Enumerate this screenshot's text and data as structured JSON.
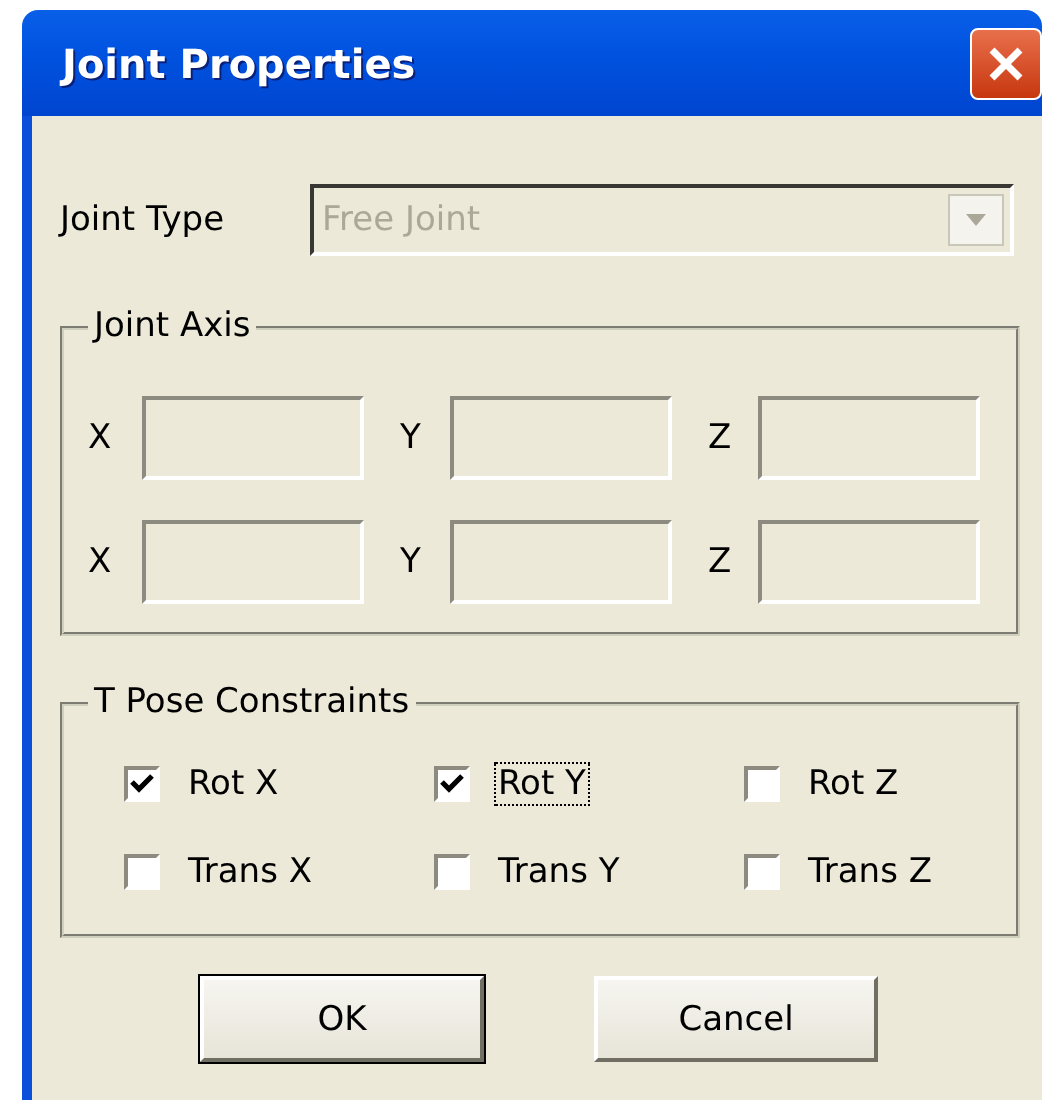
{
  "window": {
    "title": "Joint Properties"
  },
  "joint_type": {
    "label": "Joint Type",
    "value": "Free Joint",
    "disabled": true
  },
  "joint_axis": {
    "title": "Joint Axis",
    "rows": [
      [
        {
          "label": "X",
          "disabled": true
        },
        {
          "label": "Y",
          "disabled": true
        },
        {
          "label": "Z",
          "disabled": true
        }
      ],
      [
        {
          "label": "X",
          "disabled": true
        },
        {
          "label": "Y",
          "disabled": true
        },
        {
          "label": "Z",
          "disabled": true
        }
      ]
    ]
  },
  "t_pose_constraints": {
    "title": "T Pose Constraints",
    "checkboxes": [
      {
        "label": "Rot X",
        "checked": true,
        "focused": false
      },
      {
        "label": "Rot Y",
        "checked": true,
        "focused": true
      },
      {
        "label": "Rot Z",
        "checked": false,
        "focused": false
      },
      {
        "label": "Trans X",
        "checked": false,
        "focused": false
      },
      {
        "label": "Trans Y",
        "checked": false,
        "focused": false
      },
      {
        "label": "Trans Z",
        "checked": false,
        "focused": false
      }
    ]
  },
  "buttons": [
    {
      "label": "OK",
      "default": true
    },
    {
      "label": "Cancel",
      "default": false
    }
  ]
}
